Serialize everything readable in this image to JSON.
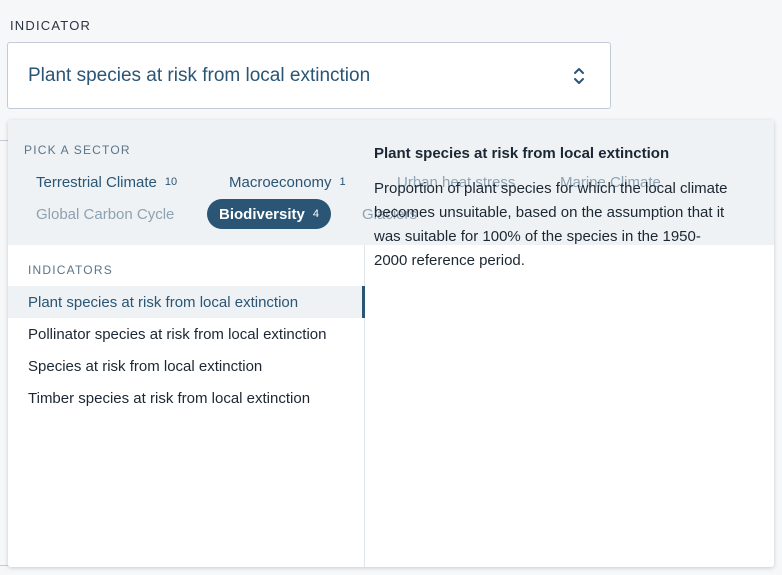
{
  "field": {
    "label": "INDICATOR",
    "selected_value": "Plant species at risk from local extinction",
    "chevron_icon": "chevron-up-down-icon"
  },
  "dropdown": {
    "sector_title": "PICK A SECTOR",
    "sectors": [
      {
        "name": "Terrestrial Climate",
        "count": "10",
        "state": "enabled"
      },
      {
        "name": "Macroeconomy",
        "count": "1",
        "state": "enabled"
      },
      {
        "name": "Urban heat stress",
        "count": "",
        "state": "disabled"
      },
      {
        "name": "Marine Climate",
        "count": "",
        "state": "disabled"
      },
      {
        "name": "Global Carbon Cycle",
        "count": "",
        "state": "disabled"
      },
      {
        "name": "Biodiversity",
        "count": "4",
        "state": "active"
      },
      {
        "name": "Glaciers",
        "count": "",
        "state": "disabled"
      }
    ],
    "indicators_title": "INDICATORS",
    "indicators": [
      {
        "label": "Plant species at risk from local extinction",
        "selected": true
      },
      {
        "label": "Pollinator species at risk from local extinction",
        "selected": false
      },
      {
        "label": "Species at risk from local extinction",
        "selected": false
      },
      {
        "label": "Timber species at risk from local extinction",
        "selected": false
      }
    ],
    "description": {
      "title": "Plant species at risk from local extinction",
      "text": "Proportion of plant species for which the local climate becomes unsuitable, based on the assumption that it was suitable for 100% of the species in the 1950-2000 reference period."
    }
  },
  "colors": {
    "accent": "#2a5575",
    "disabled_text": "#8ea2b2",
    "panel_bg": "#eef2f4"
  }
}
